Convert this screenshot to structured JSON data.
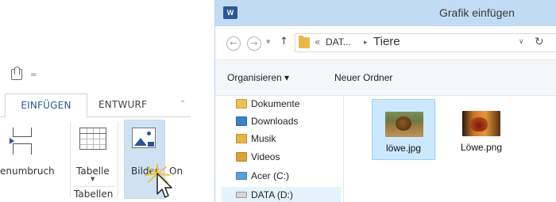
{
  "word": {
    "qat": {
      "more_glyph": "="
    },
    "tabs": [
      {
        "label": "EINFÜGEN",
        "active": true
      },
      {
        "label": "ENTWURF",
        "active": false
      }
    ],
    "ribbon": {
      "pagebreak_label": "enumbruch",
      "table_label": "Tabelle",
      "table_dropdown": "▼",
      "tables_group_label": "Tabellen",
      "pictures_label": "Bilder",
      "online_label": "On"
    },
    "colors": {
      "accent": "#2b579a",
      "highlight": "#cfe2f3"
    }
  },
  "dialog": {
    "app_icon_letter": "W",
    "title": "Grafik einfügen",
    "nav": {
      "back": "←",
      "forward": "→",
      "recent": "▼",
      "up": "↑"
    },
    "address": {
      "prefix": "«",
      "crumbs": [
        "DAT...",
        "Tiere"
      ],
      "separator": "▸",
      "dropdown": "∨",
      "refresh": "↻"
    },
    "commands": {
      "organize": "Organisieren ▾",
      "new_folder": "Neuer Ordner"
    },
    "nav_pane": {
      "items": [
        {
          "label": "Dokumente",
          "icon": "documents-folder-icon"
        },
        {
          "label": "Downloads",
          "icon": "downloads-folder-icon"
        },
        {
          "label": "Musik",
          "icon": "music-folder-icon"
        },
        {
          "label": "Videos",
          "icon": "videos-folder-icon"
        },
        {
          "label": "Acer (C:)",
          "icon": "drive-icon"
        },
        {
          "label": "DATA (D:)",
          "icon": "drive-icon"
        }
      ],
      "scroll_up": "▲"
    },
    "files": [
      {
        "name": "löwe.jpg",
        "selected": true
      },
      {
        "name": "Löwe.png",
        "selected": false
      }
    ],
    "colors": {
      "titlebar": "#c0dbf3",
      "selection": "#cce8ff"
    }
  }
}
